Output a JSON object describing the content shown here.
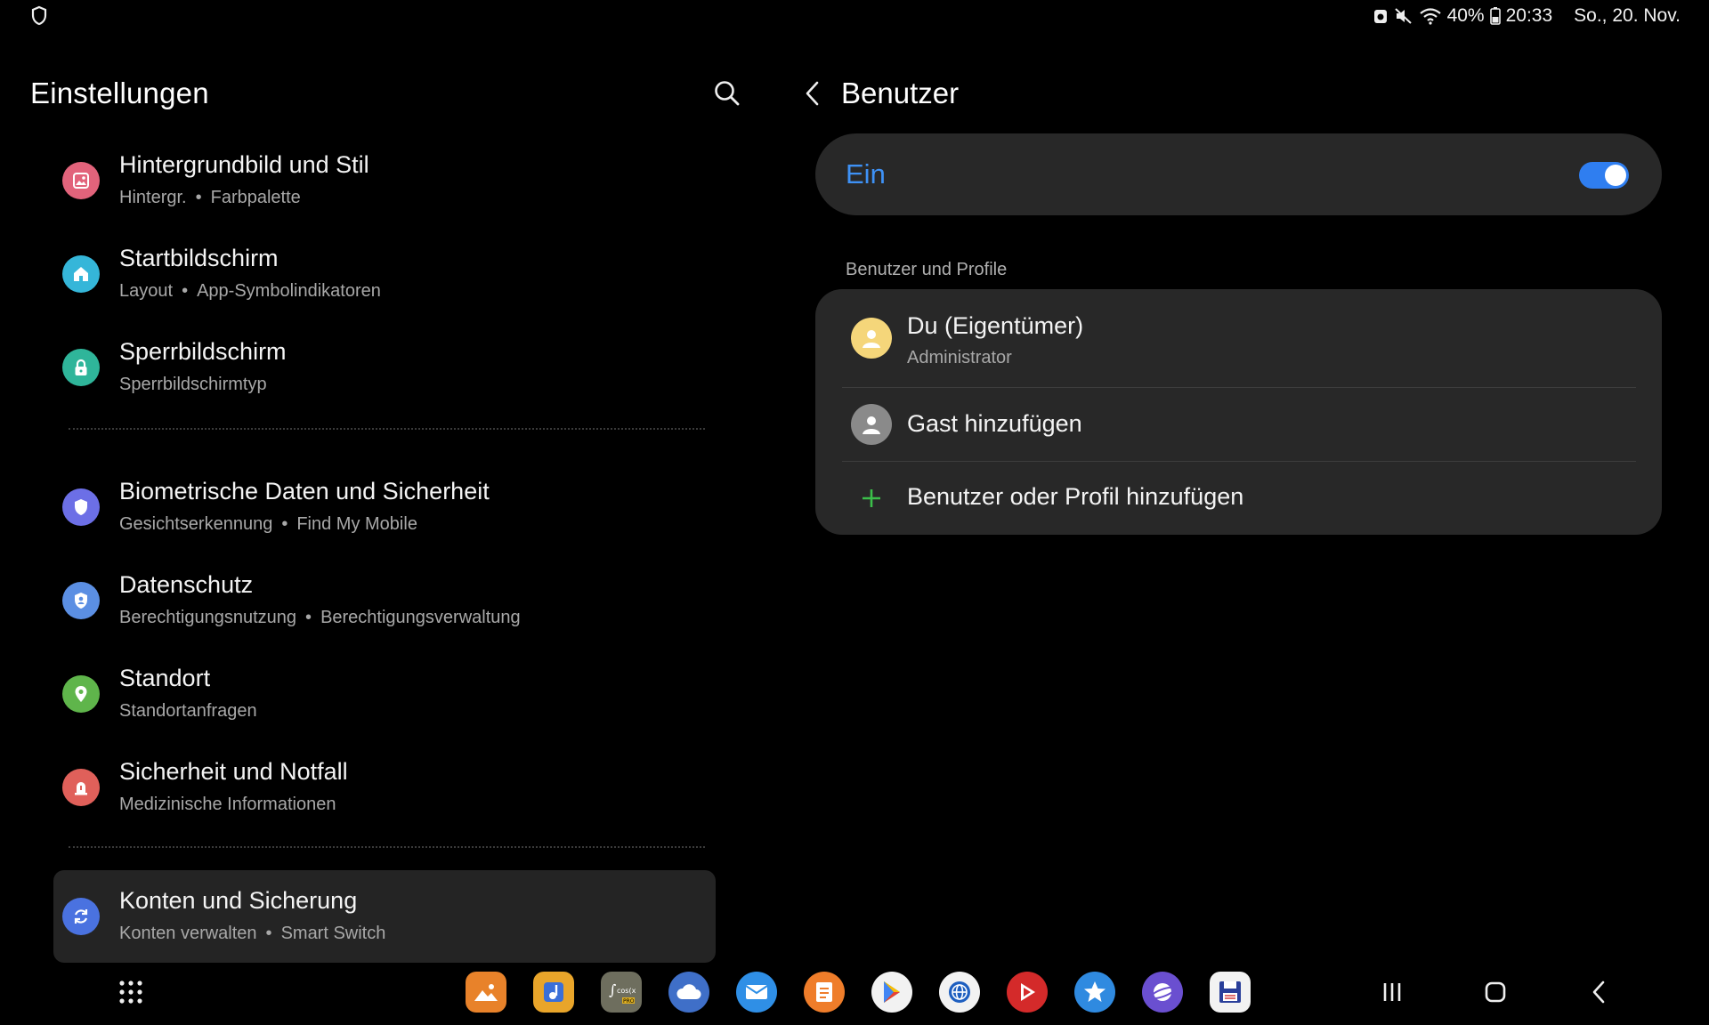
{
  "status_bar": {
    "battery_percent": "40%",
    "time": "20:33",
    "date": "So., 20. Nov."
  },
  "settings": {
    "title": "Einstellungen",
    "items": [
      {
        "title": "Hintergrundbild und Stil",
        "sub1": "Hintergr.",
        "sub2": "Farbpalette",
        "icon": "wallpaper-icon",
        "color": "#e2637b"
      },
      {
        "title": "Startbildschirm",
        "sub1": "Layout",
        "sub2": "App-Symbolindikatoren",
        "icon": "home-icon",
        "color": "#35b6d9"
      },
      {
        "title": "Sperrbildschirm",
        "sub1": "Sperrbildschirmtyp",
        "sub2": "",
        "icon": "lock-icon",
        "color": "#2fb59a"
      },
      {
        "title": "Biometrische Daten und Sicherheit",
        "sub1": "Gesichtserkennung",
        "sub2": "Find My Mobile",
        "icon": "shield-icon",
        "color": "#6c6fe6"
      },
      {
        "title": "Datenschutz",
        "sub1": "Berechtigungsnutzung",
        "sub2": "Berechtigungsverwaltung",
        "icon": "privacy-shield-icon",
        "color": "#5b8fe3"
      },
      {
        "title": "Standort",
        "sub1": "Standortanfragen",
        "sub2": "",
        "icon": "location-pin-icon",
        "color": "#5fb54b"
      },
      {
        "title": "Sicherheit und Notfall",
        "sub1": "Medizinische Informationen",
        "sub2": "",
        "icon": "emergency-icon",
        "color": "#e0605a"
      },
      {
        "title": "Konten und Sicherung",
        "sub1": "Konten verwalten",
        "sub2": "Smart Switch",
        "icon": "sync-icon",
        "color": "#4a72e0"
      }
    ]
  },
  "users": {
    "title": "Benutzer",
    "toggle_label": "Ein",
    "toggle_on": true,
    "section_label": "Benutzer und Profile",
    "owner": {
      "name": "Du (Eigentümer)",
      "role": "Administrator"
    },
    "guest_label": "Gast hinzufügen",
    "add_label": "Benutzer oder Profil hinzufügen"
  },
  "colors": {
    "accent_blue": "#3e91f5",
    "card_bg": "#282828",
    "add_green": "#3bbf4a"
  },
  "dock": {
    "apps": [
      "gallery-icon",
      "music-icon",
      "calculator-icon",
      "cloud-icon",
      "mail-icon",
      "notes-icon",
      "play-store-icon",
      "browser-icon",
      "video-icon",
      "star-app-icon",
      "internet-icon",
      "save-disk-icon"
    ]
  }
}
